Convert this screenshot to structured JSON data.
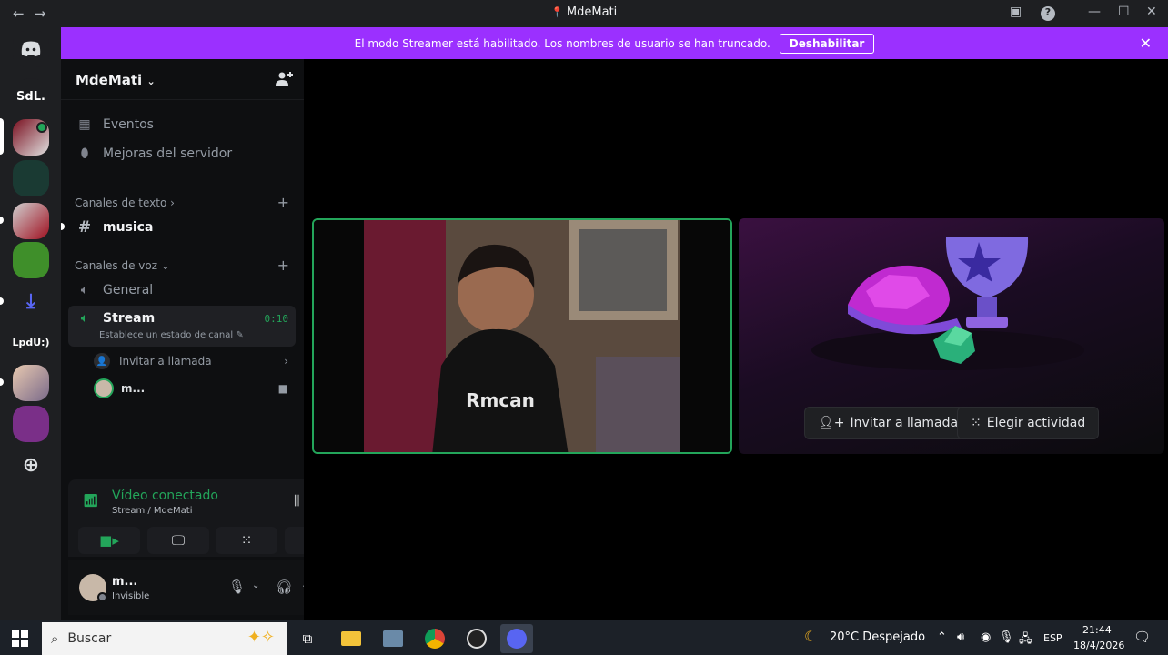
{
  "window": {
    "title": "MdeMati"
  },
  "banner": {
    "message": "El modo Streamer está habilitado. Los nombres de usuario se han truncado.",
    "button": "Deshabilitar"
  },
  "guilds": [
    {
      "label": "SdL."
    },
    {
      "label": "LpdU:)"
    }
  ],
  "server": {
    "name": "MdeMati",
    "items": [
      {
        "label": "Eventos",
        "icon": "calendar-icon"
      },
      {
        "label": "Mejoras del servidor",
        "icon": "boost-icon"
      }
    ],
    "text_category": "Canales de texto",
    "text_channels": [
      {
        "label": "musica"
      }
    ],
    "voice_category": "Canales de voz",
    "voice_channels": [
      {
        "label": "General"
      },
      {
        "label": "Stream",
        "timer": "0:10",
        "status": "Establece un estado de canal"
      }
    ],
    "invite_label": "Invitar a llamada",
    "participant": "m..."
  },
  "voice_panel": {
    "status": "Vídeo conectado",
    "location": "Stream / MdeMati"
  },
  "user": {
    "name": "m...",
    "status": "Invisible"
  },
  "activity": {
    "invite_button": "Invitar a llamada",
    "activity_button": "Elegir actividad"
  },
  "taskbar": {
    "search_placeholder": "Buscar",
    "weather": "20°C  Despejado",
    "lang": "ESP",
    "time": "21:44",
    "date": "18/4/2026"
  },
  "colors": {
    "accent": "#9b30ff",
    "green": "#23a55a"
  }
}
